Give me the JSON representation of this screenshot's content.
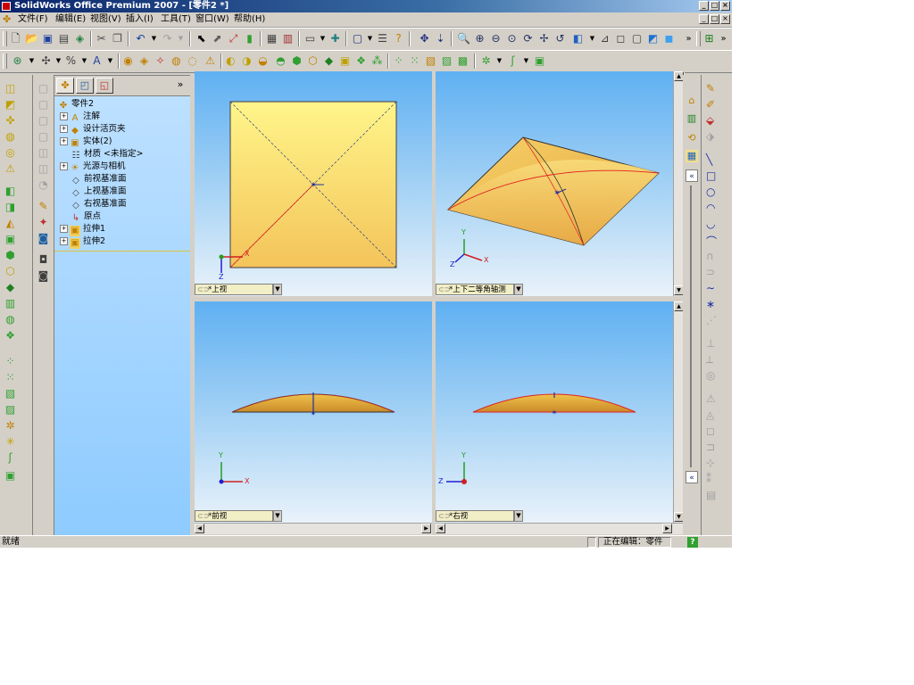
{
  "window": {
    "title": "SolidWorks Office Premium 2007 - [零件2 *]",
    "min_glyph": "_",
    "max_glyph": "□",
    "close_glyph": "×"
  },
  "menu": {
    "items": [
      {
        "label": "文件(F)"
      },
      {
        "label": "编辑(E)"
      },
      {
        "label": "视图(V)"
      },
      {
        "label": "插入(I)"
      },
      {
        "label": "工具(T)"
      },
      {
        "label": "窗口(W)"
      },
      {
        "label": "帮助(H)"
      }
    ]
  },
  "feature_manager": {
    "collapse_glyph": "»",
    "tree": [
      {
        "label": "零件2",
        "icon": "part-icon",
        "expander": ""
      },
      {
        "label": "注解",
        "icon": "annotation-icon",
        "expander": "+"
      },
      {
        "label": "设计活页夹",
        "icon": "design-binder-icon",
        "expander": "+"
      },
      {
        "label": "实体(2)",
        "icon": "solid-bodies-icon",
        "expander": "+"
      },
      {
        "label": "材质 <未指定>",
        "icon": "material-icon",
        "expander": ""
      },
      {
        "label": "光源与相机",
        "icon": "lights-camera-icon",
        "expander": "+"
      },
      {
        "label": "前视基准面",
        "icon": "plane-icon",
        "expander": ""
      },
      {
        "label": "上视基准面",
        "icon": "plane-icon",
        "expander": ""
      },
      {
        "label": "右视基准面",
        "icon": "plane-icon",
        "expander": ""
      },
      {
        "label": "原点",
        "icon": "origin-icon",
        "expander": ""
      },
      {
        "label": "拉伸1",
        "icon": "extrude-icon",
        "expander": "+"
      },
      {
        "label": "拉伸2",
        "icon": "extrude-icon",
        "expander": "+"
      }
    ]
  },
  "viewports": [
    {
      "view_name": "*上视"
    },
    {
      "view_name": "*上下二等角轴测"
    },
    {
      "view_name": "*前视"
    },
    {
      "view_name": "*右视"
    }
  ],
  "axis_labels": {
    "x": "X",
    "y": "Y",
    "z": "Z"
  },
  "status": {
    "left": "就绪",
    "right": "正在编辑：零件",
    "help_glyph": "?"
  },
  "colors": {
    "model_face": "#f0c24a",
    "model_dark": "#d89a2a",
    "sketch_red": "#e02020",
    "axis_x": "#d02020",
    "axis_y": "#20a020",
    "axis_z": "#2020d0"
  }
}
